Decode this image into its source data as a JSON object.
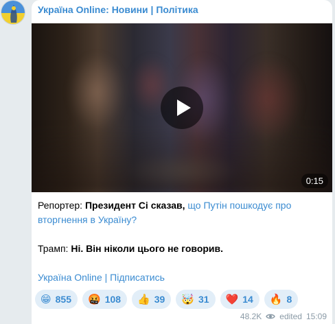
{
  "channel": {
    "title": "Україна Online: Новини | Політика"
  },
  "video": {
    "duration": "0:15"
  },
  "message": {
    "reporter_label": "Репортер:",
    "reporter_quote_bold": "Президент Сі сказав,",
    "reporter_quote_link": "що Путін пошкодує про вторгнення в Україну?",
    "trump_label": "Трамп:",
    "trump_reply": "Ні. Він ніколи цього не говорив.",
    "subscribe_link": "Україна Online | Підписатись"
  },
  "reactions": [
    {
      "emoji": "😁",
      "count": "855"
    },
    {
      "emoji": "🤬",
      "count": "108"
    },
    {
      "emoji": "👍",
      "count": "39"
    },
    {
      "emoji": "🤯",
      "count": "31"
    },
    {
      "emoji": "❤️",
      "count": "14"
    },
    {
      "emoji": "🔥",
      "count": "8"
    }
  ],
  "meta": {
    "views": "48.2K",
    "edited_label": "edited",
    "time": "15:09"
  },
  "colors": {
    "accent": "#3a8bd1",
    "reaction_bg": "#e2eef8",
    "page_bg": "#e6ebee"
  },
  "icons": {
    "avatar": "ukraine-flag-avatar",
    "views": "eye-icon",
    "play": "play-icon"
  }
}
